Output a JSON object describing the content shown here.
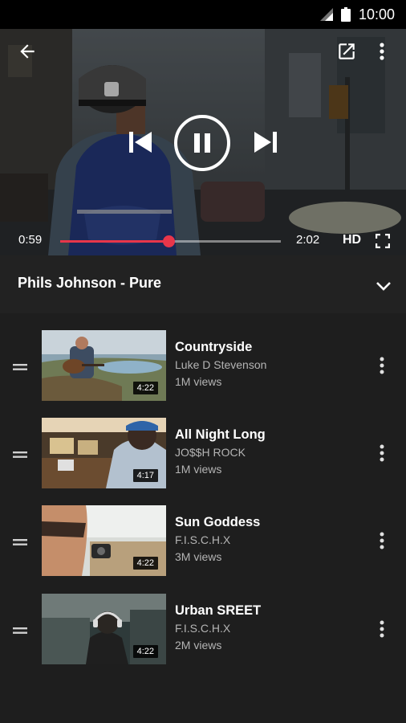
{
  "status_bar": {
    "time": "10:00",
    "icons": [
      "signal-icon",
      "battery-icon"
    ]
  },
  "player": {
    "icons": [
      "arrow-back-icon",
      "open-in-new-icon",
      "more-vert-icon",
      "skip-previous-icon",
      "pause-icon",
      "skip-next-icon",
      "fullscreen-icon"
    ],
    "elapsed": "0:59",
    "duration": "2:02",
    "progress": 0.49,
    "quality": "HD",
    "accent_color": "#e8364a"
  },
  "playlist": {
    "title": "Phils Johnson - Pure",
    "collapse_icon": "chevron-down-icon",
    "items": [
      {
        "title": "Countryside",
        "artist": "Luke D Stevenson",
        "views": "1M views",
        "duration": "4:22"
      },
      {
        "title": "All Night Long",
        "artist": "JO$$H ROCK",
        "views": "1M views",
        "duration": "4:17"
      },
      {
        "title": "Sun Goddess",
        "artist": "F.I.S.C.H.X",
        "views": "3M views",
        "duration": "4:22"
      },
      {
        "title": "Urban SREET",
        "artist": "F.I.S.C.H.X",
        "views": "2M views",
        "duration": "4:22"
      }
    ]
  }
}
